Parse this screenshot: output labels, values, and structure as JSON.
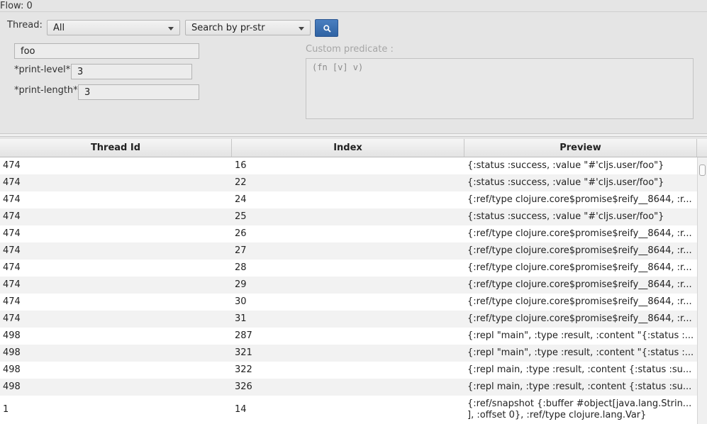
{
  "flow": {
    "label": "Flow: 0"
  },
  "toolbar": {
    "thread_label": "Thread:",
    "thread_select": "All",
    "search_mode": "Search by pr-str",
    "accent": "#2f63a3"
  },
  "filters": {
    "search_value": "foo",
    "print_level_label": "*print-level*",
    "print_level_value": "3",
    "print_length_label": "*print-length*",
    "print_length_value": "3",
    "custom_predicate_label": "Custom predicate :",
    "custom_predicate_value": "(fn [v] v)"
  },
  "table": {
    "columns": [
      "Thread Id",
      "Index",
      "Preview"
    ],
    "rows": [
      [
        "474",
        "16",
        "{:status :success, :value \"#'cljs.user/foo\"}"
      ],
      [
        "474",
        "22",
        "{:status :success, :value \"#'cljs.user/foo\"}"
      ],
      [
        "474",
        "24",
        "{:ref/type clojure.core$promise$reify__8644, :r..."
      ],
      [
        "474",
        "25",
        "{:status :success, :value \"#'cljs.user/foo\"}"
      ],
      [
        "474",
        "26",
        "{:ref/type clojure.core$promise$reify__8644, :r..."
      ],
      [
        "474",
        "27",
        "{:ref/type clojure.core$promise$reify__8644, :r..."
      ],
      [
        "474",
        "28",
        "{:ref/type clojure.core$promise$reify__8644, :r..."
      ],
      [
        "474",
        "29",
        "{:ref/type clojure.core$promise$reify__8644, :r..."
      ],
      [
        "474",
        "30",
        "{:ref/type clojure.core$promise$reify__8644, :r..."
      ],
      [
        "474",
        "31",
        "{:ref/type clojure.core$promise$reify__8644, :r..."
      ],
      [
        "498",
        "287",
        "{:repl \"main\", :type :result, :content \"{:status :..."
      ],
      [
        "498",
        "321",
        "{:repl \"main\", :type :result, :content \"{:status :..."
      ],
      [
        "498",
        "322",
        "{:repl main, :type :result, :content {:status :su..."
      ],
      [
        "498",
        "326",
        "{:repl main, :type :result, :content {:status :su..."
      ],
      [
        "1",
        "14",
        "{:ref/snapshot {:buffer #object[java.lang.Strin...\n], :offset 0}, :ref/type clojure.lang.Var}"
      ]
    ]
  },
  "icons": {
    "search_button": "search-icon",
    "dropdown": "chevron-down-icon"
  }
}
